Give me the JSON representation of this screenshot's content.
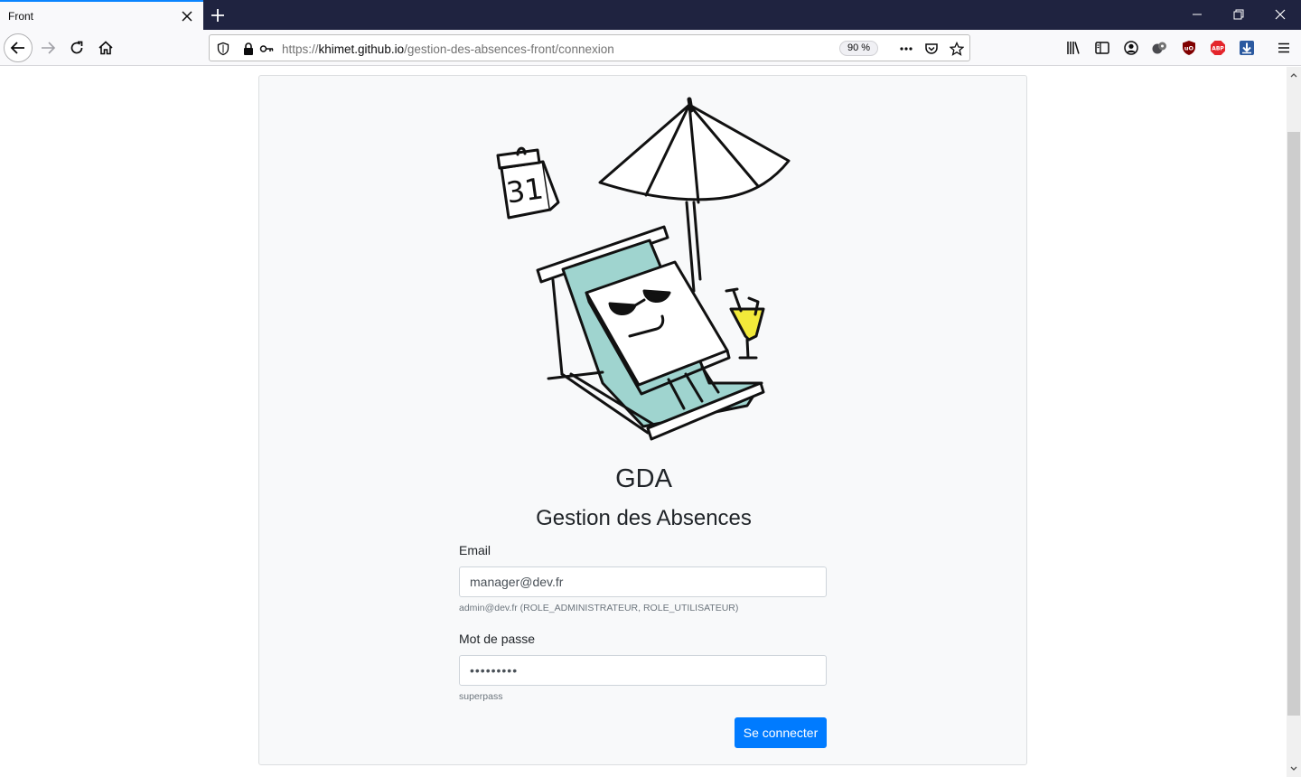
{
  "browser": {
    "tab_title": "Front",
    "url_scheme": "https://",
    "url_host": "khimet.github.io",
    "url_path": "/gestion-des-absences-front/connexion",
    "zoom": "90 %",
    "accent_color": "#0a84ff",
    "titlebar_color": "#1f2340",
    "toolbar_icons": [
      "library-icon",
      "sidebar-icon",
      "account-icon",
      "extension-icon",
      "ublock-icon",
      "adblock-plus-icon",
      "download-icon",
      "menu-icon"
    ]
  },
  "page": {
    "illustration": "beach-chair-calendar-illustration",
    "calendar_number": "31",
    "title": "GDA",
    "subtitle": "Gestion des Absences",
    "email_label": "Email",
    "email_value": "manager@dev.fr",
    "email_help": "admin@dev.fr (ROLE_ADMINISTRATEUR, ROLE_UTILISATEUR)",
    "password_label": "Mot de passe",
    "password_value": "•••••••••",
    "password_help": "superpass",
    "submit_label": "Se connecter",
    "primary_color": "#007bff"
  }
}
